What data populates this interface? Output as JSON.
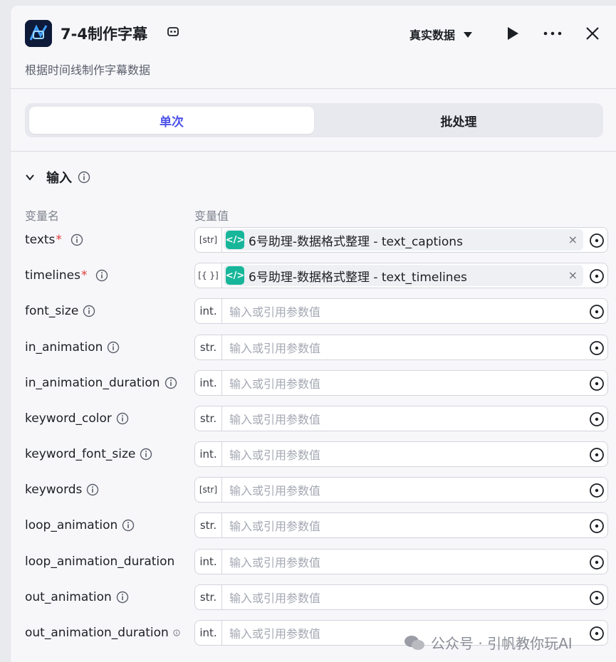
{
  "header": {
    "title": "7-4制作字幕",
    "subtitle": "根据时间线制作字幕数据",
    "mode": "真实数据"
  },
  "tabs": [
    {
      "label": "单次",
      "active": true
    },
    {
      "label": "批处理",
      "active": false
    }
  ],
  "section": {
    "title": "输入",
    "col_name": "变量名",
    "col_value": "变量值"
  },
  "rows": [
    {
      "name": "texts",
      "required": "*",
      "type": "[str]",
      "ref": "6号助理-数据格式整理 - text_captions"
    },
    {
      "name": "timelines",
      "required": "*",
      "type": "[{ }]",
      "ref": "6号助理-数据格式整理 - text_timelines"
    },
    {
      "name": "font_size",
      "type": "int.",
      "placeholder": "输入或引用参数值"
    },
    {
      "name": "in_animation",
      "type": "str.",
      "placeholder": "输入或引用参数值"
    },
    {
      "name": "in_animation_duration",
      "type": "int.",
      "placeholder": "输入或引用参数值"
    },
    {
      "name": "keyword_color",
      "type": "str.",
      "placeholder": "输入或引用参数值"
    },
    {
      "name": "keyword_font_size",
      "type": "int.",
      "placeholder": "输入或引用参数值"
    },
    {
      "name": "keywords",
      "type": "[str]",
      "placeholder": "输入或引用参数值"
    },
    {
      "name": "loop_animation",
      "type": "str.",
      "placeholder": "输入或引用参数值"
    },
    {
      "name": "loop_animation_duration",
      "type": "int.",
      "placeholder": "输入或引用参数值"
    },
    {
      "name": "out_animation",
      "type": "str.",
      "placeholder": "输入或引用参数值"
    },
    {
      "name": "out_animation_duration",
      "type": "int.",
      "placeholder": "输入或引用参数值"
    }
  ],
  "ref_icon_label": "</>",
  "ref_clear_glyph": "×",
  "watermark": "公众号 · 引帆教你玩AI",
  "colors": {
    "accent": "#4d53e8",
    "ref_icon": "#17b69a",
    "required": "#e03a3a"
  }
}
